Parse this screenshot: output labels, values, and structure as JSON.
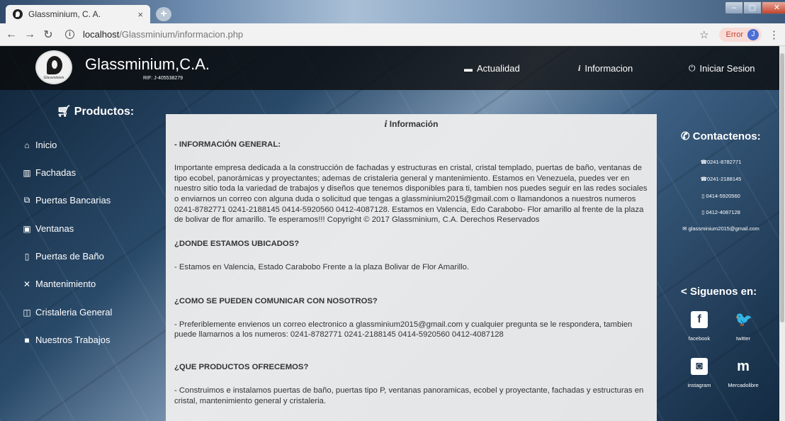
{
  "browser": {
    "tab_title": "Glassminium, C. A.",
    "tab_close": "×",
    "new_tab": "+",
    "url_host": "localhost",
    "url_path": "/Glassminium/informacion.php",
    "error_label": "Error",
    "profile_initial": "J"
  },
  "header": {
    "brand": "Glassminium,C.A.",
    "rif": "RIF: J-405538279",
    "logo_text": "Glassminium",
    "nav": [
      {
        "label": "Actualidad",
        "icon": "calendar-icon"
      },
      {
        "label": "Informacion",
        "icon": "info-icon"
      },
      {
        "label": "Iniciar Sesion",
        "icon": "power-icon"
      }
    ]
  },
  "sidebar": {
    "title": "Productos:",
    "items": [
      {
        "label": "Inicio",
        "icon": "home-icon"
      },
      {
        "label": "Fachadas",
        "icon": "building-icon"
      },
      {
        "label": "Puertas Bancarias",
        "icon": "copy-icon"
      },
      {
        "label": "Ventanas",
        "icon": "window-icon"
      },
      {
        "label": "Puertas de Baño",
        "icon": "door-icon"
      },
      {
        "label": "Mantenimiento",
        "icon": "tools-icon"
      },
      {
        "label": "Cristaleria General",
        "icon": "glass-icon"
      },
      {
        "label": "Nuestros Trabajos",
        "icon": "briefcase-icon"
      }
    ]
  },
  "content": {
    "title": "Información",
    "general_heading": "- INFORMACIÓN GENERAL:",
    "general_text": "Importante empresa dedicada a la construcción de fachadas y estructuras en cristal, cristal templado, puertas de baño, ventanas de tipo ecobel, panorámicas y proyectantes; ademas de cristaleria general y mantenimiento. Estamos en Venezuela, puedes ver en nuestro sitio toda la variedad de trabajos y diseños que tenemos disponibles para ti, tambien nos puedes seguir en las redes sociales o enviarnos un correo con alguna duda o solicitud que tengas a glassminium2015@gmail.com o llamandonos a nuestros numeros 0241-8782771 0241-2188145 0414-5920560 0412-4087128. Estamos en Valencia, Edo Carabobo- Flor amarillo al frente de la plaza de bolivar de flor amarillo. Te esperamos!!! Copyright © 2017 Glassminium, C.A. Derechos Reservados",
    "where_heading": "¿DONDE ESTAMOS UBICADOS?",
    "where_text": "- Estamos en Valencia, Estado Carabobo Frente a la plaza Bolivar de Flor Amarillo.",
    "contact_heading": "¿COMO SE PUEDEN COMUNICAR CON NOSOTROS?",
    "contact_text": "- Preferiblemente envienos un correo electronico a glassminium2015@gmail.com y cualquier pregunta se le respondera, tambien puede llamarnos a los numeros: 0241-8782771 0241-2188145 0414-5920560 0412-4087128",
    "products_heading": "¿QUE PRODUCTOS OFRECEMOS?",
    "products_text": "- Construimos e instalamos puertas de baño, puertas tipo P, ventanas panoramicas, ecobel y proyectante, fachadas y estructuras en cristal, mantenimiento general y cristaleria."
  },
  "contact": {
    "title": "Contactenos:",
    "lines": [
      "☎0241-8782771",
      "☎0241-2188145",
      "▯ 0414-5920560",
      "▯ 0412-4087128",
      "✉ glassminium2015@gmail.com"
    ]
  },
  "social": {
    "title": "Siguenos en:",
    "items": [
      {
        "label": "facebook",
        "glyph": "f",
        "icon": "facebook-icon"
      },
      {
        "label": "twitter",
        "glyph": "🐦",
        "icon": "twitter-icon"
      },
      {
        "label": "instagram",
        "glyph": "◙",
        "icon": "instagram-icon"
      },
      {
        "label": "Mercadolibre",
        "glyph": "m",
        "icon": "mercadolibre-icon"
      }
    ]
  }
}
